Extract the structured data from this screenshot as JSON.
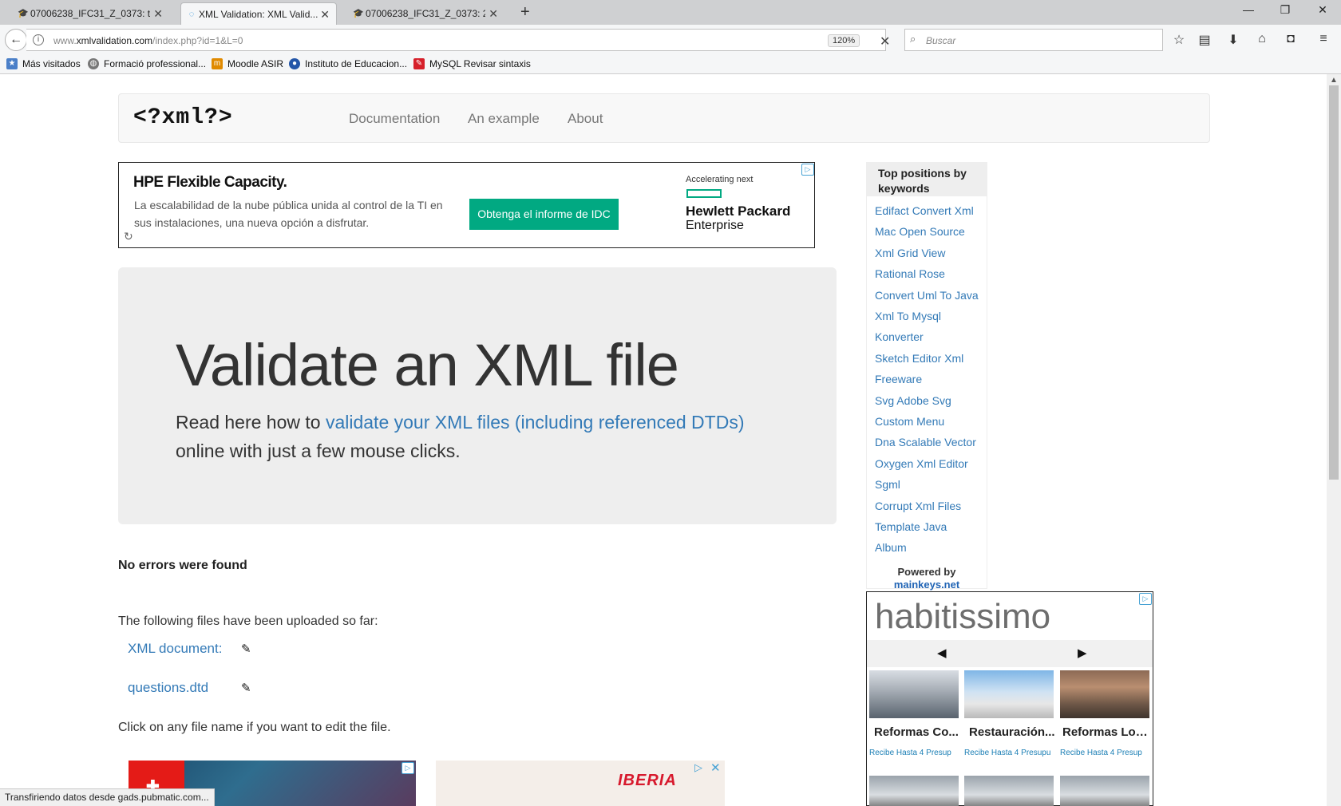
{
  "browser": {
    "tabs": [
      {
        "title": "07006238_IFC31_Z_0373: ti...",
        "active": false,
        "favicon": "moodle-icon"
      },
      {
        "title": "XML Validation: XML Valid...",
        "active": true,
        "favicon": "loading-icon"
      },
      {
        "title": "07006238_IFC31_Z_0373: 2....",
        "active": false,
        "favicon": "moodle-icon"
      }
    ],
    "url_prefix": "www.",
    "url_domain": "xmlvalidation.com",
    "url_path": "/index.php?id=1&L=0",
    "zoom": "120%",
    "search_placeholder": "Buscar",
    "bookmarks": [
      {
        "label": "Más visitados",
        "icon": "most-visited-icon"
      },
      {
        "label": "Formació professional...",
        "icon": "globe-icon"
      },
      {
        "label": "Moodle ASIR",
        "icon": "moodle-icon"
      },
      {
        "label": "Instituto de Educacion...",
        "icon": "school-icon"
      },
      {
        "label": "MySQL Revisar sintaxis",
        "icon": "mysql-icon"
      }
    ],
    "status": "Transfiriendo datos desde gads.pubmatic.com..."
  },
  "site": {
    "logo": "<?xml?>",
    "nav": [
      "Documentation",
      "An example",
      "About"
    ]
  },
  "ad_top": {
    "title": "HPE Flexible Capacity.",
    "description": "La escalabilidad de la nube pública unida al control de la TI en sus instalaciones, una nueva opción a disfrutar.",
    "cta": "Obtenga el informe de IDC",
    "tagline": "Accelerating next",
    "brand_line1": "Hewlett Packard",
    "brand_line2": "Enterprise"
  },
  "jumbotron": {
    "heading": "Validate an XML file",
    "text_before": "Read here how to ",
    "link_text": "validate your XML files (including referenced DTDs)",
    "text_after": " online with just a few mouse clicks."
  },
  "result": {
    "status": "No errors were found",
    "uploaded_intro": "The following files have been uploaded so far:",
    "files": [
      "XML document:",
      "questions.dtd"
    ],
    "hint": "Click on any file name if you want to edit the file."
  },
  "keywords": {
    "title": "Top positions by keywords",
    "items": [
      "Edifact Convert Xml",
      "Mac Open Source",
      "Xml Grid View",
      "Rational Rose",
      "Convert Uml To Java",
      "Xml To Mysql",
      "Konverter",
      "Sketch Editor Xml",
      "Freeware",
      "Svg Adobe Svg",
      "Custom Menu",
      "Dna Scalable Vector",
      "Oxygen Xml Editor",
      "Sgml",
      "Corrupt Xml Files",
      "Template Java",
      "Album"
    ],
    "powered_by": "Powered by",
    "powered_link": "mainkeys.net"
  },
  "ad_side": {
    "brand": "habitissimo",
    "cards": [
      {
        "title": "Reformas Co...",
        "sub": "Recibe Hasta 4 Presup"
      },
      {
        "title": "Restauración...",
        "sub": "Recibe Hasta 4 Presupu"
      },
      {
        "title": "Reformas Loc...",
        "sub": "Recibe Hasta 4 Presup"
      }
    ]
  },
  "ad_bottom": {
    "brand": "IBERIA"
  }
}
